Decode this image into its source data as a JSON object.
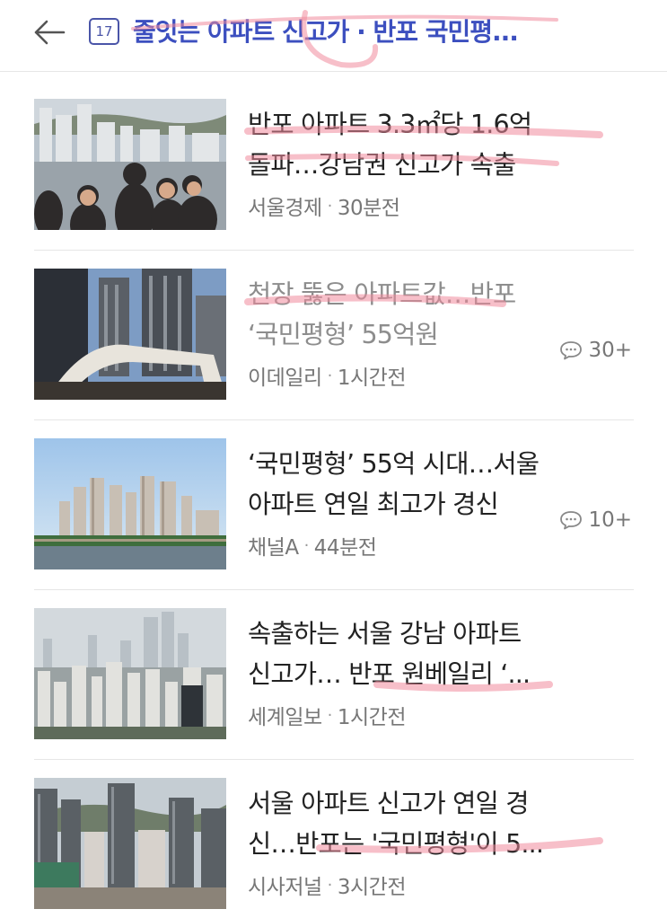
{
  "header": {
    "back_icon": "arrow-left-icon",
    "calendar_icon": "calendar-icon",
    "date_badge": "17",
    "title": "줄잇는 아파트 신고가 · 반포 국민평...",
    "accent_color": "#3c4fbf"
  },
  "articles": [
    {
      "title_line1": "반포 아파트 3.3㎡당 1.6억",
      "title_line2": "돌파…강남권 신고가 속출",
      "source": "서울경제",
      "time": "30분전",
      "comments": "",
      "read": false
    },
    {
      "title_line1": "천장 뚫은 아파트값…반포",
      "title_line2": "‘국민평형’ 55억원",
      "source": "이데일리",
      "time": "1시간전",
      "comments": "30+",
      "read": true
    },
    {
      "title_line1": "‘국민평형’ 55억 시대…서울",
      "title_line2": "아파트 연일 최고가 경신",
      "source": "채널A",
      "time": "44분전",
      "comments": "10+",
      "read": false
    },
    {
      "title_line1": "속출하는 서울 강남 아파트",
      "title_line2": "신고가… 반포 원베일리 ‘...",
      "source": "세계일보",
      "time": "1시간전",
      "comments": "",
      "read": false
    },
    {
      "title_line1": "서울 아파트 신고가 연일 경",
      "title_line2": "신…반포는 '국민평형'이 5...",
      "source": "시사저널",
      "time": "3시간전",
      "comments": "",
      "read": false
    }
  ]
}
